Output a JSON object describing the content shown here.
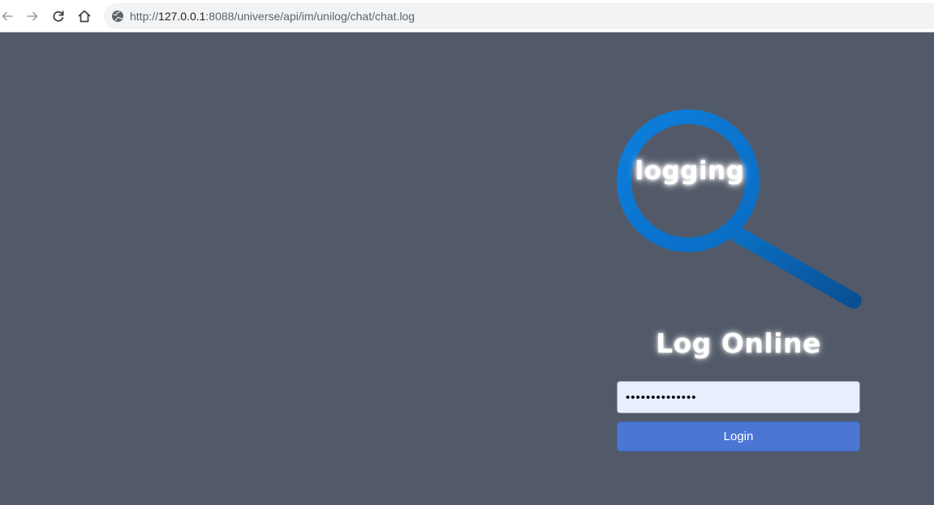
{
  "browser": {
    "url_scheme": "http://",
    "url_host": "127.0.0.1",
    "url_rest": ":8088/universe/api/im/unilog/chat/chat.log",
    "icons": [
      "back-arrow-icon",
      "forward-arrow-icon",
      "reload-icon",
      "home-icon",
      "site-info-icon"
    ]
  },
  "page": {
    "logo_text": "logging",
    "title": "Log Online",
    "password_value": "••••••••••••••",
    "login_label": "Login"
  },
  "colors": {
    "background": "#525a69",
    "magnifier_blue": "#0a7bd6",
    "button": "#4b76d3",
    "input_autofill": "#e8f0fe"
  }
}
